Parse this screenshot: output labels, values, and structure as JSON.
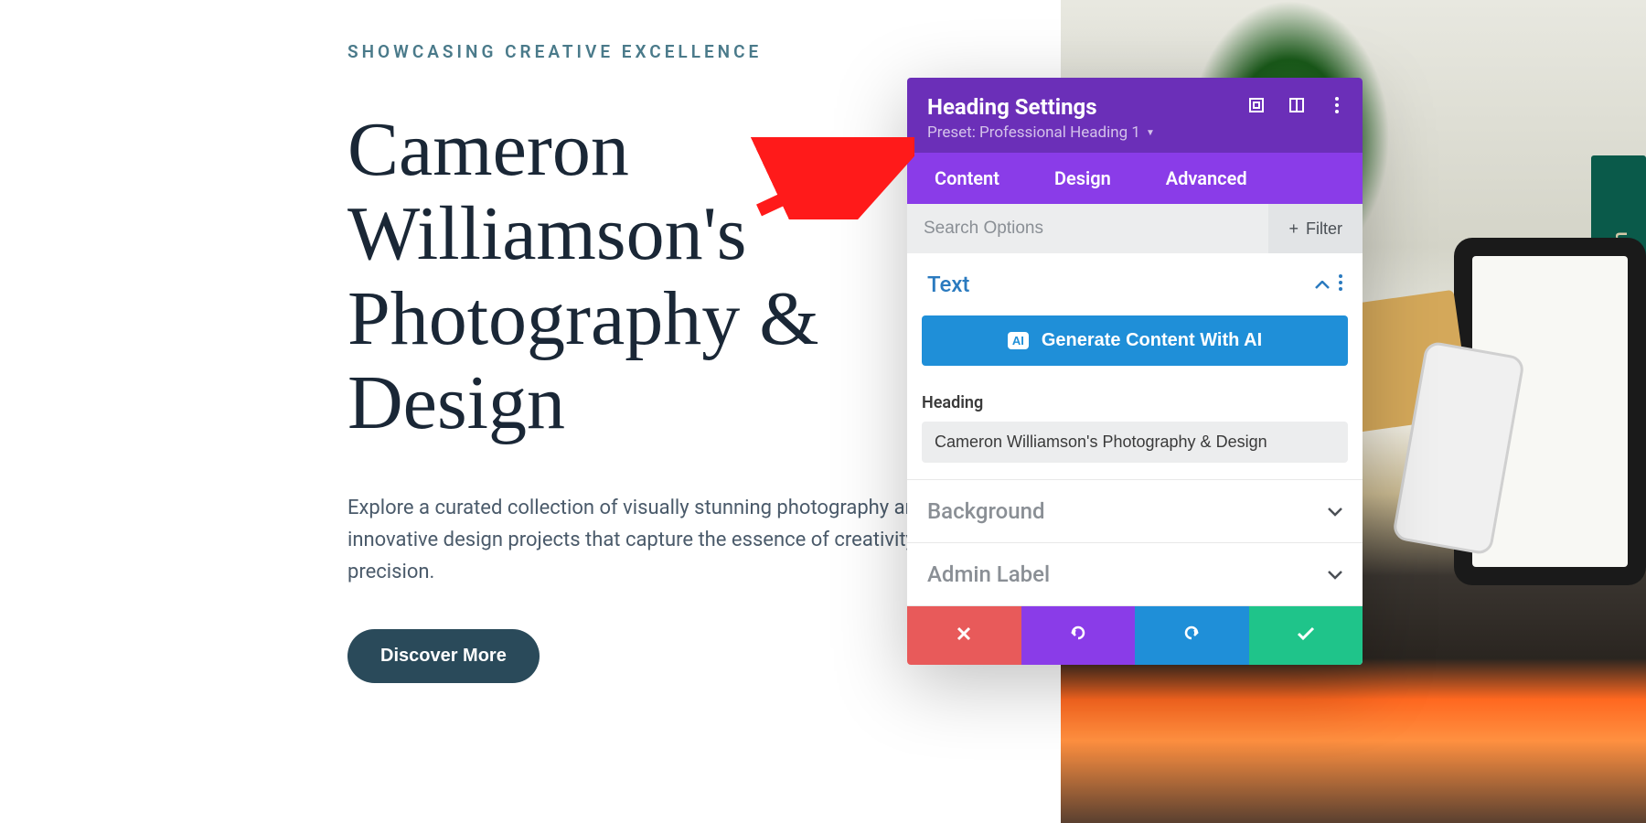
{
  "content": {
    "eyebrow": "SHOWCASING CREATIVE EXCELLENCE",
    "heading": "Cameron Williamson's Photography & Design",
    "description": "Explore a curated collection of visually stunning photography and innovative design projects that capture the essence of creativity and precision.",
    "cta": "Discover More"
  },
  "panel": {
    "title": "Heading Settings",
    "preset_label": "Preset: Professional Heading 1",
    "tabs": {
      "content": "Content",
      "design": "Design",
      "advanced": "Advanced"
    },
    "search_placeholder": "Search Options",
    "filter_label": "Filter",
    "sections": {
      "text": {
        "title": "Text",
        "generate_label": "Generate Content With AI",
        "ai_badge": "AI",
        "heading_field_label": "Heading",
        "heading_field_value": "Cameron Williamson's Photography & Design"
      },
      "background": {
        "title": "Background"
      },
      "admin_label": {
        "title": "Admin Label"
      }
    }
  }
}
